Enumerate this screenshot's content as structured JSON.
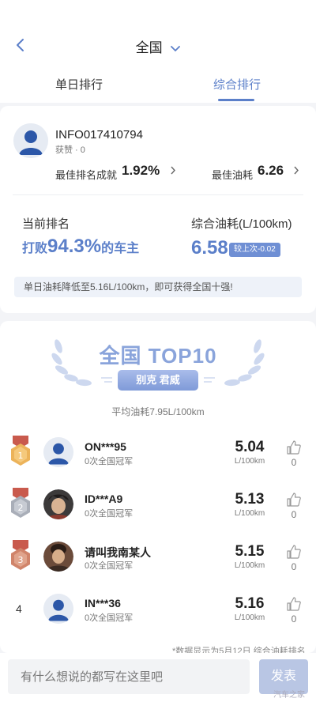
{
  "header": {
    "title": "全国",
    "tabs": [
      {
        "label": "单日排行",
        "active": false
      },
      {
        "label": "综合排行",
        "active": true
      }
    ]
  },
  "profile": {
    "username": "INFO017410794",
    "likes": "获赞 · 0",
    "best_rank_label": "最佳排名成就",
    "best_rank_value": "1.92%",
    "best_fuel_label": "最佳油耗",
    "best_fuel_value": "6.26"
  },
  "current": {
    "rank_label": "当前排名",
    "beat_prefix": "打败",
    "beat_value": "94.3%",
    "beat_suffix": "的车主",
    "fuel_label": "综合油耗(L/100km)",
    "fuel_value": "6.58",
    "compare_badge": "较上次-0.02",
    "tip": "单日油耗降低至5.16L/100km，即可获得全国十强!"
  },
  "top10": {
    "title": "全国 TOP10",
    "brand": "别克 君威",
    "avg": "平均油耗7.95L/100km",
    "entries": [
      {
        "rank": "1",
        "name": "ON***95",
        "sub": "0次全国冠军",
        "value": "5.04",
        "unit": "L/100km",
        "likes": "0",
        "avatar": "default"
      },
      {
        "rank": "2",
        "name": "ID***A9",
        "sub": "0次全国冠军",
        "value": "5.13",
        "unit": "L/100km",
        "likes": "0",
        "avatar": "photo"
      },
      {
        "rank": "3",
        "name": "请叫我南某人",
        "sub": "0次全国冠军",
        "value": "5.15",
        "unit": "L/100km",
        "likes": "0",
        "avatar": "photo"
      },
      {
        "rank": "4",
        "name": "IN***36",
        "sub": "0次全国冠军",
        "value": "5.16",
        "unit": "L/100km",
        "likes": "0",
        "avatar": "default"
      }
    ],
    "footnote": "*数据显示为5月12日 综合油耗排名"
  },
  "composer": {
    "placeholder": "有什么想说的都写在这里吧",
    "send_label": "发表"
  },
  "watermark": "汽车之家",
  "colors": {
    "accent": "#5b7fc9",
    "gold": "#e3a44a",
    "silver": "#a9aeb8",
    "bronze": "#d0846a"
  }
}
